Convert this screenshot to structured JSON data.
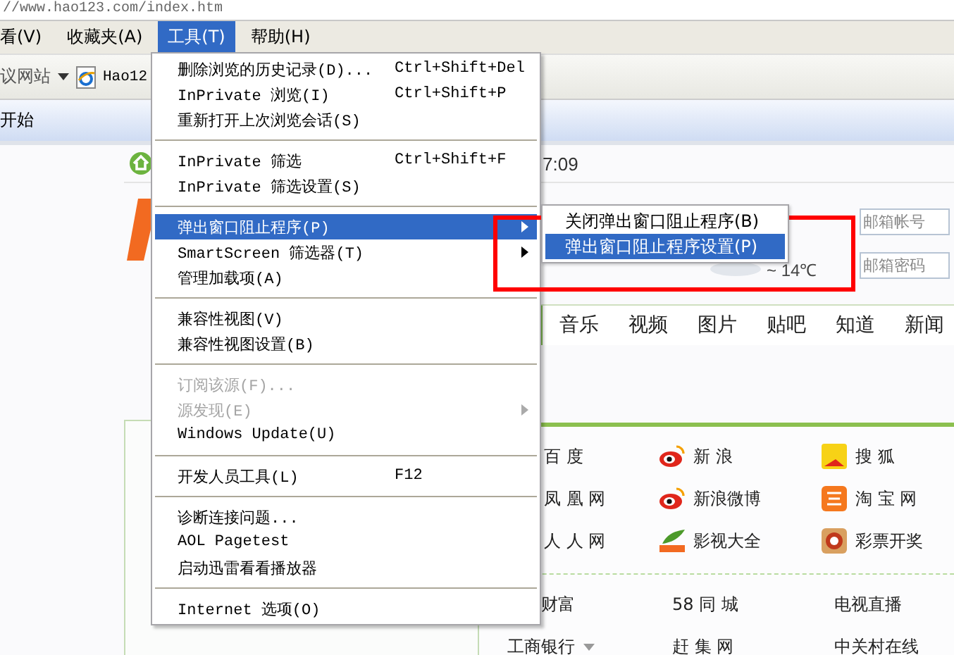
{
  "address_bar": {
    "url": "//www.hao123.com/index.htm"
  },
  "menu_bar": [
    {
      "label": "看(V)",
      "selected": false
    },
    {
      "label": "收藏夹(A)",
      "selected": false
    },
    {
      "label": "工具(T)",
      "selected": true
    },
    {
      "label": "帮助(H)",
      "selected": false
    }
  ],
  "favorites_bar": [
    {
      "label": "议网站",
      "kind": "dropdown"
    },
    {
      "label": "Hao12",
      "kind": "page"
    }
  ],
  "tab": {
    "label": "开始"
  },
  "page": {
    "time": "7:09",
    "weather": "~ 14℃",
    "email_fields": [
      {
        "placeholder": "邮箱帐号"
      },
      {
        "placeholder": "邮箱密码"
      }
    ],
    "nav_tabs": [
      "音乐",
      "视频",
      "图片",
      "贴吧",
      "知道",
      "新闻"
    ],
    "sites": [
      [
        "百 度",
        "新 浪",
        "搜 狐"
      ],
      [
        "凤 凰 网",
        "新浪微博",
        "淘 宝 网"
      ],
      [
        "人 人 网",
        "影视大全",
        "彩票开奖"
      ]
    ],
    "links": [
      [
        {
          "label": "财富",
          "dropdown": false
        },
        {
          "label": "58 同 城",
          "dropdown": false
        },
        {
          "label": "电视直播",
          "dropdown": false
        }
      ],
      [
        {
          "label": "工商银行",
          "dropdown": true
        },
        {
          "label": "赶 集 网",
          "dropdown": false
        },
        {
          "label": "中关村在线",
          "dropdown": false
        }
      ]
    ]
  },
  "tools_menu": [
    {
      "kind": "item",
      "label": "删除浏览的历史记录(D)...",
      "shortcut": "Ctrl+Shift+Del",
      "disabled": false,
      "submenu": false,
      "selected": false
    },
    {
      "kind": "item",
      "label": "InPrivate 浏览(I)",
      "shortcut": "Ctrl+Shift+P",
      "disabled": false,
      "submenu": false,
      "selected": false
    },
    {
      "kind": "item",
      "label": "重新打开上次浏览会话(S)",
      "disabled": false,
      "submenu": false,
      "selected": false
    },
    {
      "kind": "separator"
    },
    {
      "kind": "item",
      "label": "InPrivate 筛选",
      "shortcut": "Ctrl+Shift+F",
      "disabled": false,
      "submenu": false,
      "selected": false
    },
    {
      "kind": "item",
      "label": "InPrivate 筛选设置(S)",
      "disabled": false,
      "submenu": false,
      "selected": false
    },
    {
      "kind": "separator"
    },
    {
      "kind": "item",
      "label": "弹出窗口阻止程序(P)",
      "disabled": false,
      "submenu": true,
      "selected": true
    },
    {
      "kind": "item",
      "label": "SmartScreen 筛选器(T)",
      "disabled": false,
      "submenu": true,
      "selected": false
    },
    {
      "kind": "item",
      "label": "管理加载项(A)",
      "disabled": false,
      "submenu": false,
      "selected": false
    },
    {
      "kind": "separator"
    },
    {
      "kind": "item",
      "label": "兼容性视图(V)",
      "disabled": false,
      "submenu": false,
      "selected": false
    },
    {
      "kind": "item",
      "label": "兼容性视图设置(B)",
      "disabled": false,
      "submenu": false,
      "selected": false
    },
    {
      "kind": "separator"
    },
    {
      "kind": "item",
      "label": "订阅该源(F)...",
      "disabled": true,
      "submenu": false,
      "selected": false
    },
    {
      "kind": "item",
      "label": "源发现(E)",
      "disabled": true,
      "submenu": true,
      "selected": false
    },
    {
      "kind": "item",
      "label": "Windows Update(U)",
      "disabled": false,
      "submenu": false,
      "selected": false
    },
    {
      "kind": "separator"
    },
    {
      "kind": "item",
      "label": "开发人员工具(L)",
      "shortcut": "F12",
      "disabled": false,
      "submenu": false,
      "selected": false
    },
    {
      "kind": "separator"
    },
    {
      "kind": "item",
      "label": "诊断连接问题...",
      "disabled": false,
      "submenu": false,
      "selected": false
    },
    {
      "kind": "item",
      "label": "AOL Pagetest",
      "disabled": false,
      "submenu": false,
      "selected": false
    },
    {
      "kind": "item",
      "label": "启动迅雷看看播放器",
      "disabled": false,
      "submenu": false,
      "selected": false
    },
    {
      "kind": "separator"
    },
    {
      "kind": "item",
      "label": "Internet 选项(O)",
      "disabled": false,
      "submenu": false,
      "selected": false
    }
  ],
  "popup_submenu": [
    {
      "label": "关闭弹出窗口阻止程序(B)",
      "selected": false
    },
    {
      "label": "弹出窗口阻止程序设置(P)",
      "selected": true
    }
  ],
  "highlight_frame": {
    "shown": true
  }
}
